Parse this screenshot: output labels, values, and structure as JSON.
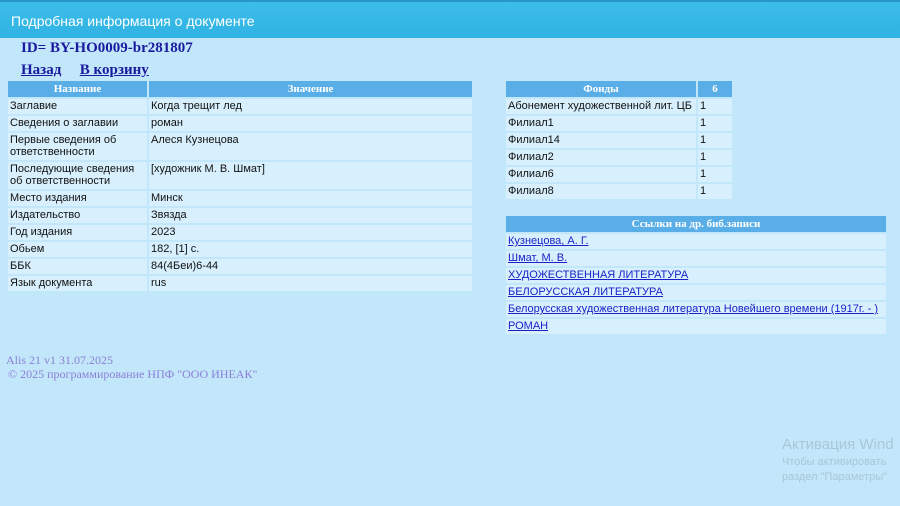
{
  "window": {
    "title": "Подробная информация о документе"
  },
  "document": {
    "id_text": "ID= BY-HO0009-br281807"
  },
  "nav": {
    "back": "Назад",
    "cart": "В корзину"
  },
  "details": {
    "headers": [
      "Название",
      "Значение"
    ],
    "rows": [
      [
        "Заглавие",
        "Когда трещит лед"
      ],
      [
        "Сведения о заглавии",
        "роман"
      ],
      [
        "Первые сведения об ответственности",
        "Алеся Кузнецова"
      ],
      [
        "Последующие сведения об ответственности",
        "[художник М. В. Шмат]"
      ],
      [
        "Место издания",
        "Минск"
      ],
      [
        "Издательство",
        "Звязда"
      ],
      [
        "Год издания",
        "2023"
      ],
      [
        "Обьем",
        "182, [1] с."
      ],
      [
        "ББК",
        "84(4Беи)6-44"
      ],
      [
        "Язык документа",
        "rus"
      ]
    ]
  },
  "funds": {
    "headers": [
      "Фонды",
      "6"
    ],
    "rows": [
      [
        "Абонемент художественной лит. ЦБ",
        "1"
      ],
      [
        "Филиал1",
        "1"
      ],
      [
        "Филиал14",
        "1"
      ],
      [
        "Филиал2",
        "1"
      ],
      [
        "Филиал6",
        "1"
      ],
      [
        "Филиал8",
        "1"
      ]
    ]
  },
  "links": {
    "header": "Ссылки на др. биб.записи",
    "items": [
      "Кузнецова, А. Г.",
      "Шмат, М. В.",
      "ХУДОЖЕСТВЕННАЯ ЛИТЕРАТУРА",
      "БЕЛОРУССКАЯ ЛИТЕРАТУРА",
      "Белорусская художественная литература Новейшего времени (1917г. - )",
      "РОМАН"
    ]
  },
  "footer": {
    "version": "Alis 21 v1 31.07.2025",
    "copyright": "© 2025 программирование НПФ \"ООО ИНЕАК\""
  },
  "watermark": {
    "title": "Активация Wind",
    "line1": "Чтобы активировать",
    "line2": "раздел \"Параметры\""
  },
  "colors": {
    "background": "#c2e7fb",
    "titlebar": "#2fb3e3",
    "header_cell": "#5aaee7",
    "cell": "#d8f0fd",
    "link": "#1a22c8"
  }
}
